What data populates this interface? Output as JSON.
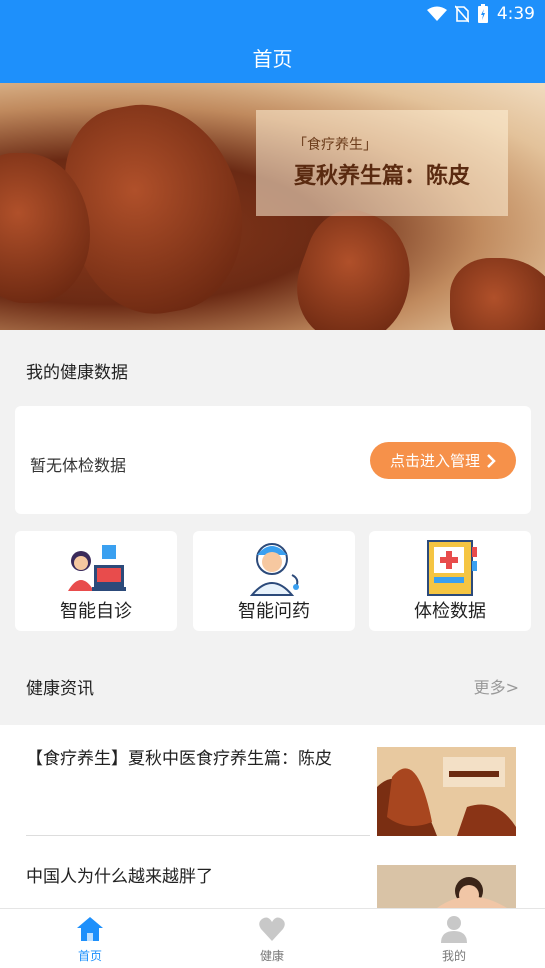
{
  "status_bar": {
    "time": "4:39"
  },
  "header": {
    "title": "首页"
  },
  "banner": {
    "tag": "「食疗养生」",
    "headline": "夏秋养生篇：陈皮"
  },
  "health_section": {
    "title": "我的健康数据",
    "empty_text": "暂无体检数据",
    "manage_label": "点击进入管理"
  },
  "features": [
    {
      "label": "智能自诊",
      "icon": "doctor-consult-icon"
    },
    {
      "label": "智能问药",
      "icon": "nurse-icon"
    },
    {
      "label": "体检数据",
      "icon": "medical-record-icon"
    }
  ],
  "news_section": {
    "title": "健康资讯",
    "more_label": "更多>",
    "items": [
      {
        "title": "【食疗养生】夏秋中医食疗养生篇：陈皮"
      },
      {
        "title": "中国人为什么越来越胖了"
      }
    ]
  },
  "tabs": [
    {
      "label": "首页",
      "icon": "home-icon",
      "active": true
    },
    {
      "label": "健康",
      "icon": "heart-icon",
      "active": false
    },
    {
      "label": "我的",
      "icon": "user-icon",
      "active": false
    }
  ],
  "colors": {
    "primary": "#1e90fb",
    "accent": "#f6914a"
  }
}
